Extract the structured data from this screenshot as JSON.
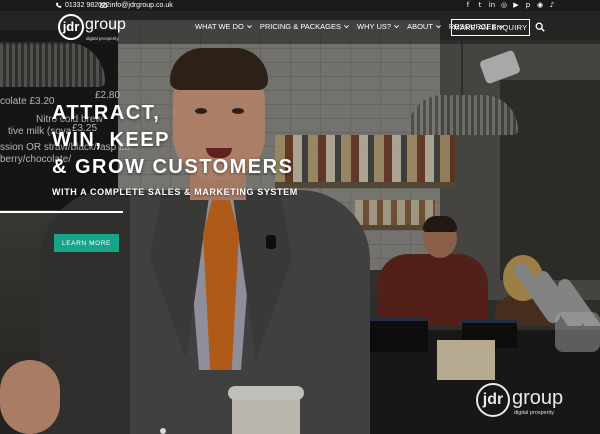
{
  "topbar": {
    "phone": "01332 982022",
    "email": "info@jdrgroup.co.uk",
    "socials": [
      {
        "icon": "facebook-icon",
        "glyph": "f"
      },
      {
        "icon": "twitter-icon",
        "glyph": "t"
      },
      {
        "icon": "linkedin-icon",
        "glyph": "in"
      },
      {
        "icon": "instagram-icon",
        "glyph": "◎"
      },
      {
        "icon": "youtube-icon",
        "glyph": "▶"
      },
      {
        "icon": "pinterest-icon",
        "glyph": "p"
      },
      {
        "icon": "messenger-icon",
        "glyph": "◉"
      },
      {
        "icon": "tiktok-icon",
        "glyph": "♪"
      }
    ]
  },
  "logo": {
    "mark": "jdr",
    "word": "group",
    "tagline": "digital prosperity"
  },
  "nav": {
    "items": [
      {
        "label": "WHAT WE DO",
        "has_dropdown": true
      },
      {
        "label": "PRICING & PACKAGES",
        "has_dropdown": true
      },
      {
        "label": "WHY US?",
        "has_dropdown": true
      },
      {
        "label": "ABOUT",
        "has_dropdown": true
      },
      {
        "label": "RESOURCES",
        "has_dropdown": true
      }
    ],
    "cta": "MAKE AN ENQUIRY"
  },
  "hero": {
    "title_lines": [
      "ATTRACT,",
      "WIN, KEEP",
      "& GROW CUSTOMERS"
    ],
    "subtitle": "WITH A COMPLETE SALES & MARKETING SYSTEM",
    "button": "LEARN MORE"
  },
  "background_menu_board": [
    "colate £3.20",
    "£2.80",
    "Nitro cold brew",
    "tive milk (soya",
    "£3.25",
    "ssion OR straw/black/rasp £3.",
    "berry/chocolate/"
  ],
  "colors": {
    "accent": "#17a589",
    "tie": "#e0741f",
    "text": "#ffffff"
  }
}
